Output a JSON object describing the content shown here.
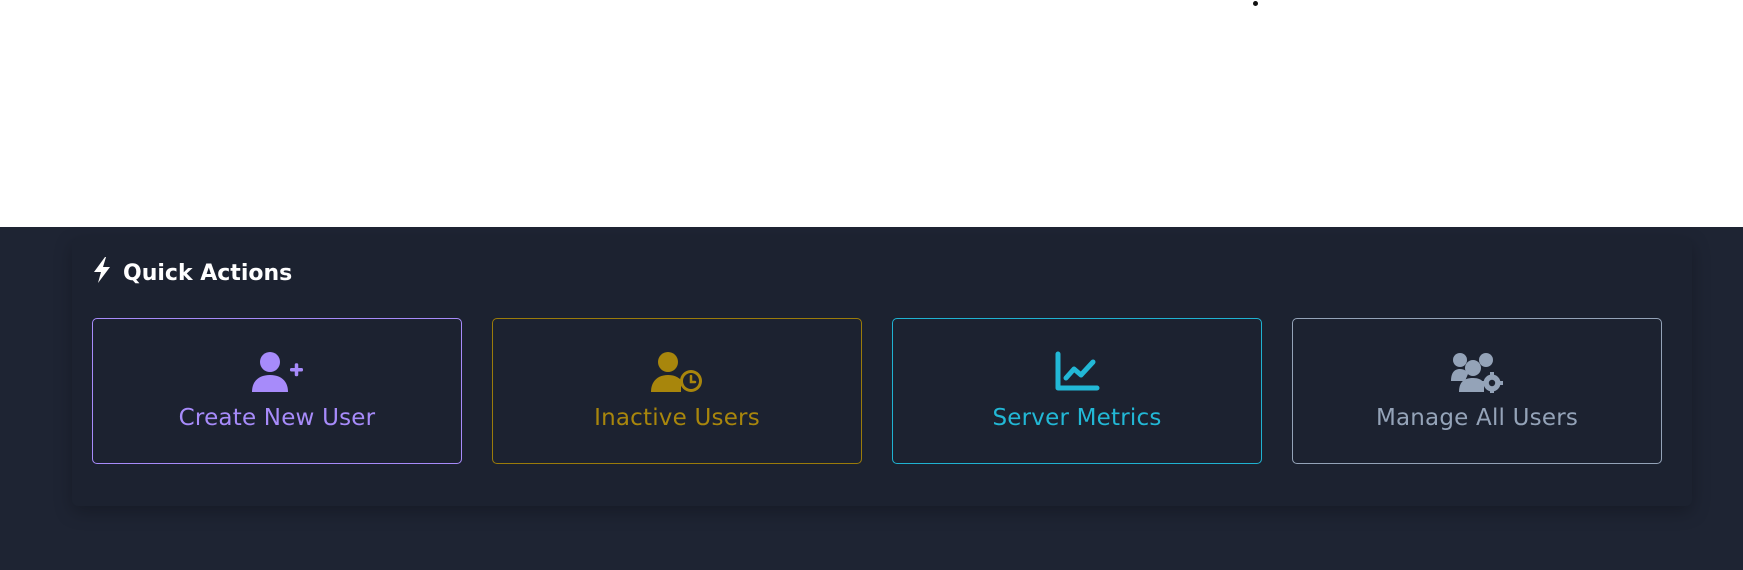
{
  "quick_actions": {
    "title": "Quick Actions",
    "title_icon": "bolt-icon",
    "buttons": [
      {
        "label": "Create New User",
        "icon": "user-plus-icon",
        "color": "#a78bfa"
      },
      {
        "label": "Inactive Users",
        "icon": "user-clock-icon",
        "color": "#a8860c"
      },
      {
        "label": "Server Metrics",
        "icon": "chart-line-icon",
        "color": "#22b8d6"
      },
      {
        "label": "Manage All Users",
        "icon": "users-cog-icon",
        "color": "#94a3b8"
      }
    ]
  }
}
